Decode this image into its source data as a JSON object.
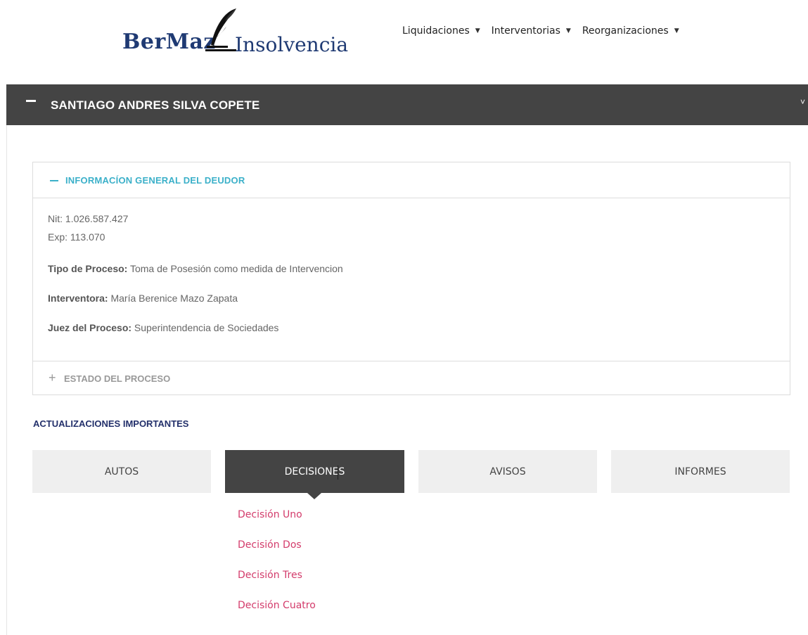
{
  "header": {
    "logo_brand": "BerMaz",
    "logo_suffix": "Insolvencia",
    "nav": [
      {
        "label": "Liquidaciones",
        "caret": "▼"
      },
      {
        "label": "Interventorias",
        "caret": "▼"
      },
      {
        "label": "Reorganizaciones",
        "caret": "▼"
      }
    ]
  },
  "main_bar": {
    "title": "SANTIAGO ANDRES SILVA COPETE",
    "chevron": "˅"
  },
  "info_panel": {
    "heading": "INFORMACÍON GENERAL DEL DEUDOR",
    "nit": "Nit: 1.026.587.427",
    "exp": "Exp: 113.070",
    "tipo_label": "Tipo de Proceso:",
    "tipo_value": " Toma de Posesión como medida de Intervencion",
    "interventora_label": "Interventora:",
    "interventora_value": " María Berenice Mazo Zapata",
    "juez_label": "Juez del Proceso:",
    "juez_value": " Superintendencia de Sociedades",
    "estado_heading": "ESTADO DEL PROCESO"
  },
  "updates": {
    "title": "ACTUALIZACIONES IMPORTANTES",
    "tabs": [
      {
        "label": "AUTOS"
      },
      {
        "label": "DECISIONES"
      },
      {
        "label": "AVISOS"
      },
      {
        "label": "INFORMES"
      }
    ],
    "active_tab": "DECISIONES",
    "dropdown": [
      "Decisión Uno",
      "Decisión Dos",
      "Decisión Tres",
      "Decisión Cuatro"
    ]
  },
  "colors": {
    "brand_blue": "#1f3a73",
    "dark_bar": "#444444",
    "accent_teal": "#3bb0c9",
    "link_pink": "#d33b6b",
    "section_navy": "#23306b"
  }
}
